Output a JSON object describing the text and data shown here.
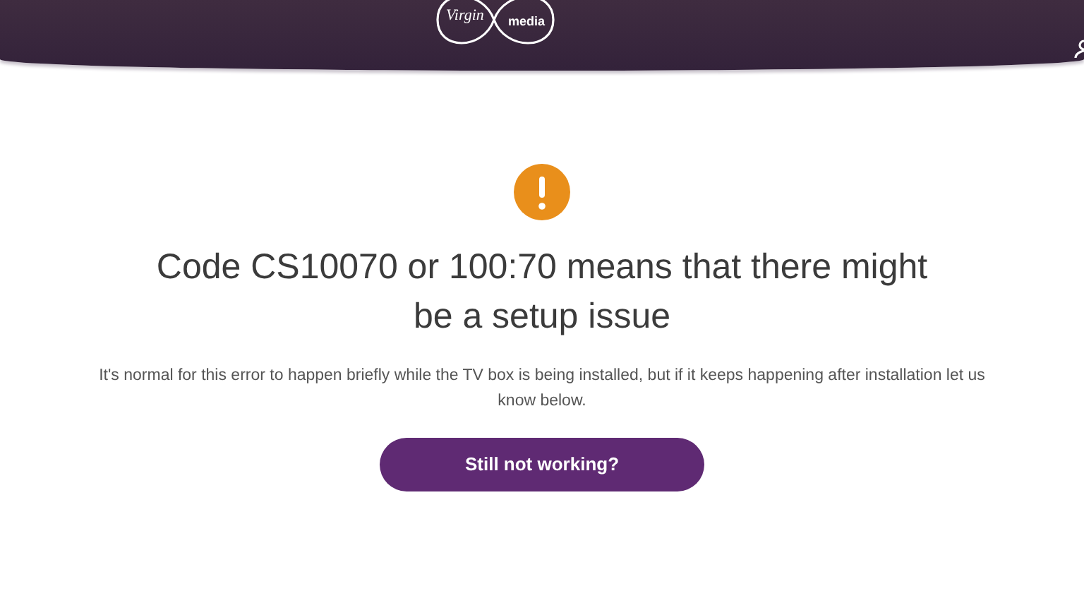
{
  "header": {
    "logo": {
      "brand": "Virgin",
      "sub": "media"
    }
  },
  "alert": {
    "title": "Code CS10070 or 100:70 means that there might be a setup issue",
    "body": "It's normal for this error to happen briefly while the TV box is being installed, but if it keeps happening after installation let us know below.",
    "button": "Still not working?"
  }
}
